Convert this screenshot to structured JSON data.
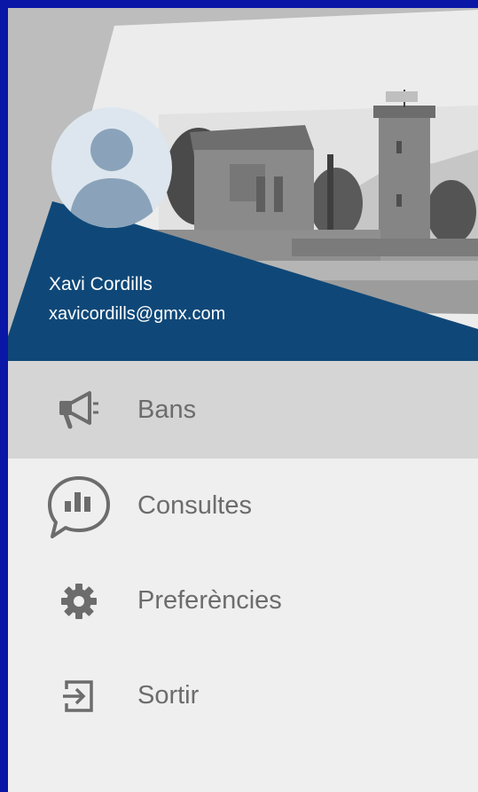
{
  "user": {
    "name": "Xavi Cordills",
    "email": "xavicordills@gmx.com"
  },
  "menu": {
    "items": [
      {
        "label": "Bans",
        "icon": "megaphone-icon",
        "active": true
      },
      {
        "label": "Consultes",
        "icon": "poll-chat-icon",
        "active": false
      },
      {
        "label": "Preferències",
        "icon": "gear-icon",
        "active": false
      },
      {
        "label": "Sortir",
        "icon": "logout-icon",
        "active": false
      }
    ]
  },
  "colors": {
    "frame": "#0a16a6",
    "header_accent": "#0f4878",
    "active_item_bg": "#d5d5d5",
    "drawer_bg": "#efefef",
    "icon": "#6c6c6c"
  }
}
